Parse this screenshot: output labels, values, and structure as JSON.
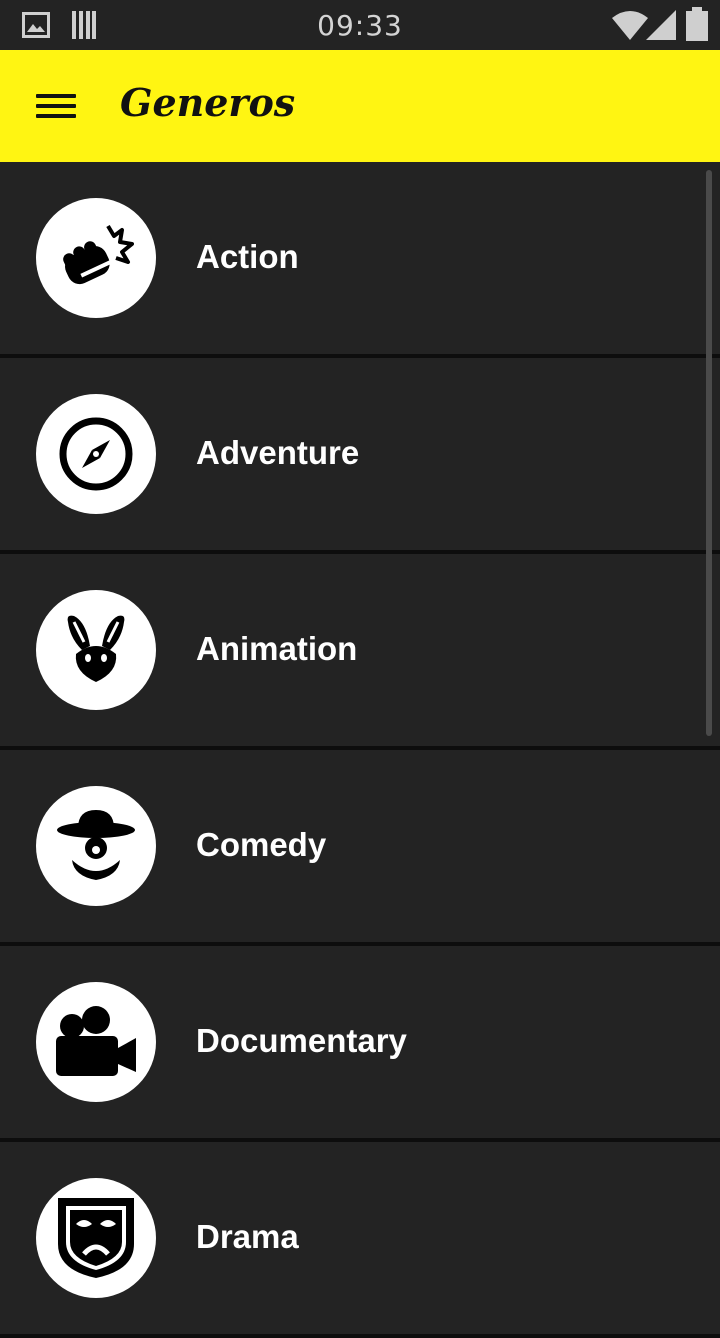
{
  "status_bar": {
    "time": "09:33"
  },
  "app_bar": {
    "title": "Generos"
  },
  "genres": [
    {
      "label": "Action",
      "icon": "fist-icon"
    },
    {
      "label": "Adventure",
      "icon": "compass-icon"
    },
    {
      "label": "Animation",
      "icon": "rabbit-icon"
    },
    {
      "label": "Comedy",
      "icon": "clown-icon"
    },
    {
      "label": "Documentary",
      "icon": "video-camera-icon"
    },
    {
      "label": "Drama",
      "icon": "drama-mask-icon"
    }
  ],
  "colors": {
    "app_bar": "#fff512",
    "background": "#232323",
    "text": "#ffffff"
  }
}
